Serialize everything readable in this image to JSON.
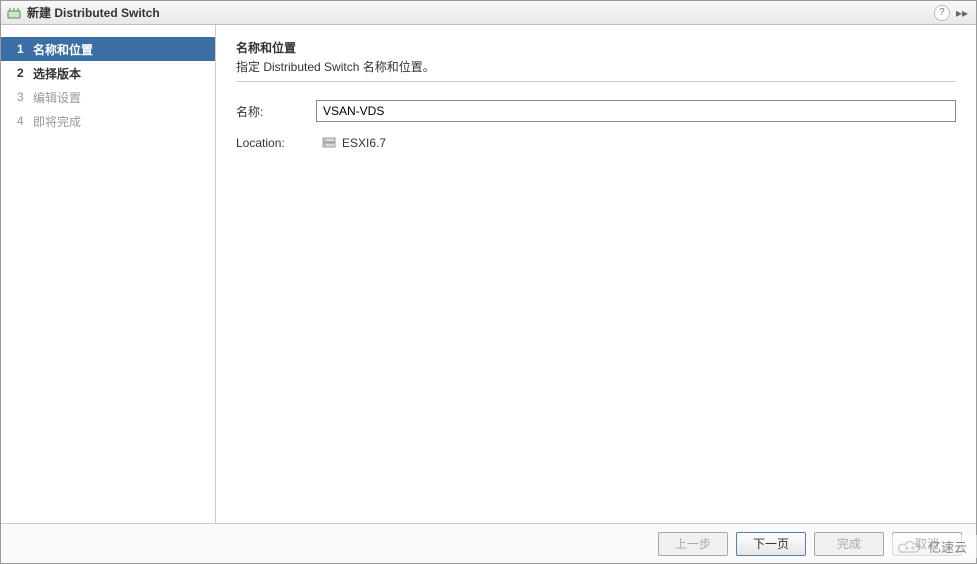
{
  "titlebar": {
    "title": "新建 Distributed Switch"
  },
  "sidebar": {
    "steps": [
      {
        "num": "1",
        "label": "名称和位置"
      },
      {
        "num": "2",
        "label": "选择版本"
      },
      {
        "num": "3",
        "label": "编辑设置"
      },
      {
        "num": "4",
        "label": "即将完成"
      }
    ]
  },
  "main": {
    "title": "名称和位置",
    "subtitle": "指定 Distributed Switch 名称和位置。",
    "name_label": "名称:",
    "name_value": "VSAN-VDS",
    "location_label": "Location:",
    "location_value": "ESXI6.7"
  },
  "footer": {
    "back_label": "上一步",
    "next_label": "下一页",
    "finish_label": "完成",
    "cancel_label": "取消"
  },
  "watermark": {
    "text": "亿速云"
  }
}
